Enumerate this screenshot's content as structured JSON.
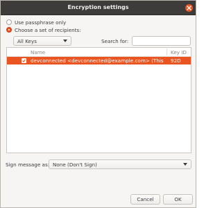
{
  "window": {
    "title": "Encryption settings"
  },
  "options": {
    "passphrase_label": "Use passphrase only",
    "recipients_label": "Choose a set of recipients:",
    "selected": "recipients"
  },
  "filter": {
    "value": "All Keys"
  },
  "search": {
    "label": "Search for:",
    "value": ""
  },
  "table": {
    "columns": {
      "name": "Name",
      "key_id": "Key ID"
    },
    "rows": [
      {
        "checked": true,
        "name": "devconnected <devconnected@example.com> (This i...",
        "key_id": "92D",
        "selected": true
      }
    ]
  },
  "sign": {
    "label": "Sign message as:",
    "value": "None (Don't Sign)"
  },
  "buttons": {
    "cancel": "Cancel",
    "ok": "OK"
  },
  "colors": {
    "accent": "#e95420",
    "titlebar": "#3d3c3a",
    "background": "#f6f5f4"
  }
}
